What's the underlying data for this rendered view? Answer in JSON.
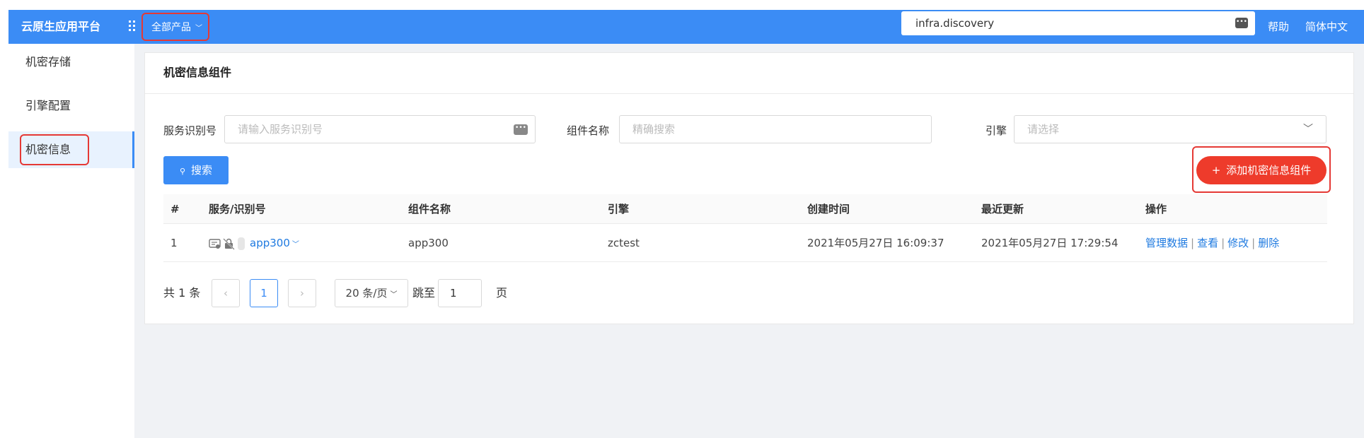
{
  "header": {
    "brand": "云原生应用平台",
    "products_label": "全部产品",
    "search_value": "infra.discovery",
    "help_label": "帮助",
    "lang_label": "简体中文",
    "accent_color": "#3b8cf5",
    "highlight_color": "#e53935"
  },
  "sidebar": {
    "items": [
      {
        "label": "机密存储"
      },
      {
        "label": "引擎配置"
      },
      {
        "label": "机密信息"
      }
    ]
  },
  "main": {
    "title": "机密信息组件",
    "filters": {
      "service_label": "服务识别号",
      "service_placeholder": "请输入服务识别号",
      "component_label": "组件名称",
      "component_placeholder": "精确搜索",
      "engine_label": "引擎",
      "engine_placeholder": "请选择"
    },
    "search_button": "搜索",
    "add_button": "添加机密信息组件",
    "table": {
      "columns": [
        "#",
        "服务/识别号",
        "组件名称",
        "引擎",
        "创建时间",
        "最近更新",
        "操作"
      ],
      "rows": [
        {
          "index": "1",
          "service": "app300",
          "component": "app300",
          "engine": "zctest",
          "created": "2021年05月27日 16:09:37",
          "updated": "2021年05月27日 17:29:54"
        }
      ],
      "actions": [
        "管理数据",
        "查看",
        "修改",
        "删除"
      ]
    },
    "pagination": {
      "total": "共 1 条",
      "prev": "‹",
      "current_page": "1",
      "next": "›",
      "page_size": "20 条/页",
      "jump_label": "跳至",
      "jump_value": "1",
      "page_suffix": "页"
    }
  }
}
